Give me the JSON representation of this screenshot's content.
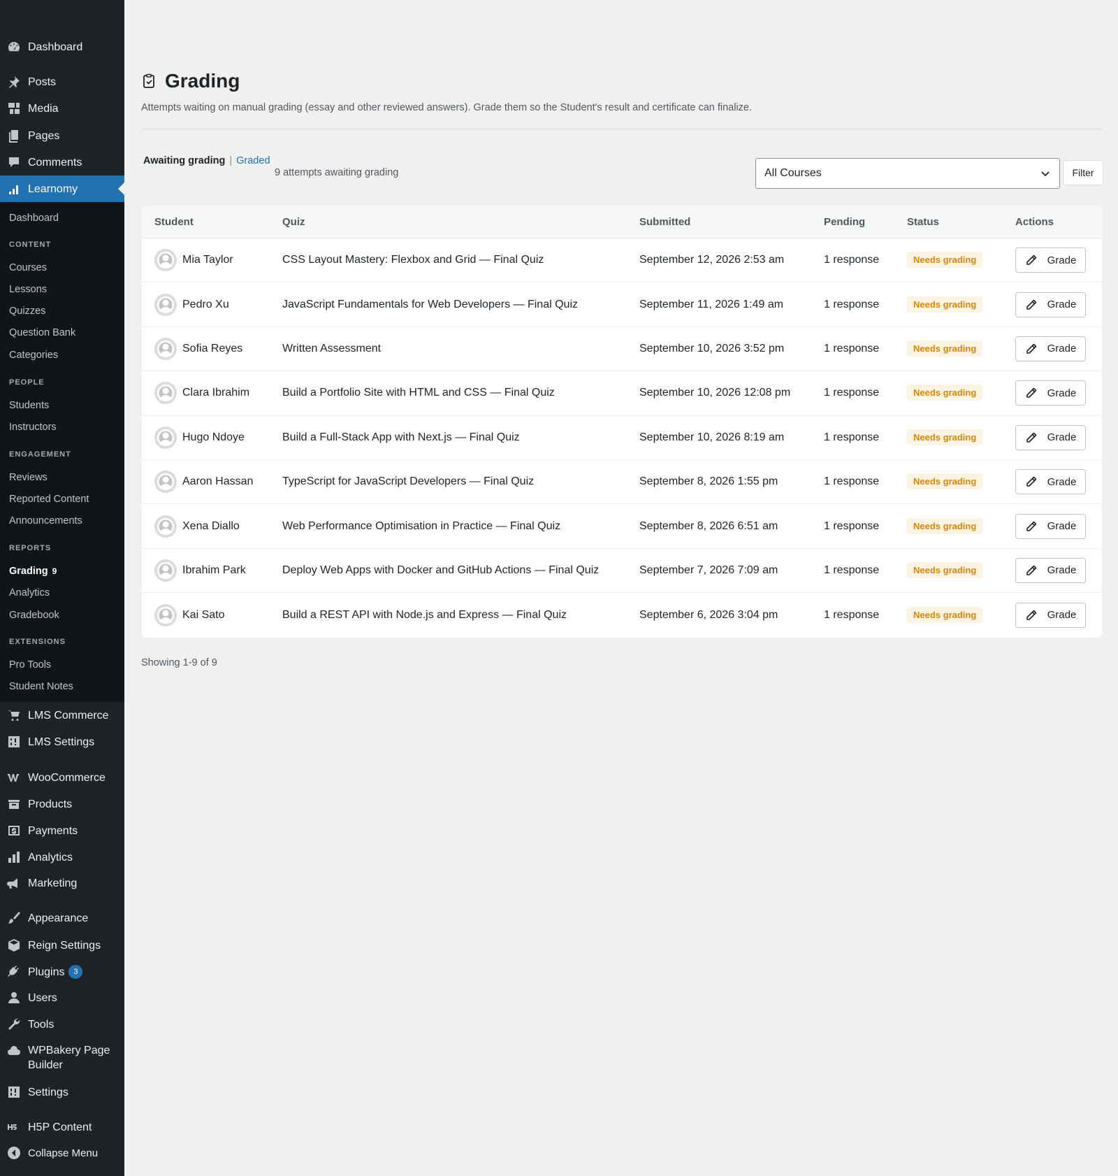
{
  "sidebar": {
    "top_items": [
      {
        "label": "Dashboard",
        "icon": "dashboard-icon"
      },
      {
        "label": "Posts",
        "icon": "pin-icon"
      },
      {
        "label": "Media",
        "icon": "media-icon"
      },
      {
        "label": "Pages",
        "icon": "pages-icon"
      },
      {
        "label": "Comments",
        "icon": "comment-icon"
      },
      {
        "label": "Learnomy",
        "icon": "chart-icon"
      }
    ],
    "submenu": {
      "dashboard": "Dashboard",
      "content_heading": "CONTENT",
      "content": [
        "Courses",
        "Lessons",
        "Quizzes",
        "Question Bank",
        "Categories"
      ],
      "people_heading": "PEOPLE",
      "people": [
        "Students",
        "Instructors"
      ],
      "engagement_heading": "ENGAGEMENT",
      "engagement": [
        "Reviews",
        "Reported Content",
        "Announcements"
      ],
      "reports_heading": "REPORTS",
      "grading": "Grading",
      "grading_count": "9",
      "reports": [
        "Analytics",
        "Gradebook"
      ],
      "extensions_heading": "EXTENSIONS",
      "extensions": [
        "Pro Tools",
        "Student Notes"
      ]
    },
    "bottom_items": [
      {
        "label": "LMS Commerce",
        "icon": "cart-icon"
      },
      {
        "label": "LMS Settings",
        "icon": "settings-grid-icon"
      },
      {
        "label": "WooCommerce",
        "icon": "woo-icon"
      },
      {
        "label": "Products",
        "icon": "archive-icon"
      },
      {
        "label": "Payments",
        "icon": "dollar-icon"
      },
      {
        "label": "Analytics",
        "icon": "bar-chart-icon"
      },
      {
        "label": "Marketing",
        "icon": "megaphone-icon"
      },
      {
        "label": "Appearance",
        "icon": "brush-icon"
      },
      {
        "label": "Reign Settings",
        "icon": "cube-icon"
      },
      {
        "label": "Plugins",
        "icon": "plug-icon",
        "count": "3"
      },
      {
        "label": "Users",
        "icon": "user-icon"
      },
      {
        "label": "Tools",
        "icon": "wrench-icon"
      },
      {
        "label": "WPBakery Page\nBuilder",
        "icon": "cloud-icon"
      },
      {
        "label": "Settings",
        "icon": "sliders-icon"
      },
      {
        "label": "H5P Content",
        "icon": "h5p-icon"
      },
      {
        "label": "Collapse Menu",
        "icon": "collapse-icon"
      }
    ]
  },
  "page": {
    "title": "Grading",
    "description": "Attempts waiting on manual grading (essay and other reviewed answers). Grade them so the Student's result and certificate can finalize.",
    "views": {
      "current": "Awaiting grading",
      "separator": "|",
      "other": "Graded"
    },
    "attempt_count": "9 attempts awaiting grading",
    "course_filter": "All Courses",
    "filter_button": "Filter",
    "showing": "Showing 1-9 of 9"
  },
  "table": {
    "headers": [
      "Student",
      "Quiz",
      "Submitted",
      "Pending",
      "Status",
      "Actions"
    ],
    "rows": [
      {
        "student": "Mia Taylor",
        "quiz": "CSS Layout Mastery: Flexbox and Grid — Final Quiz",
        "submitted": "September 12, 2026 2:53 am",
        "pending": "1 response",
        "status": "Needs grading",
        "action": "Grade"
      },
      {
        "student": "Pedro Xu",
        "quiz": "JavaScript Fundamentals for Web Developers — Final Quiz",
        "submitted": "September 11, 2026 1:49 am",
        "pending": "1 response",
        "status": "Needs grading",
        "action": "Grade"
      },
      {
        "student": "Sofia Reyes",
        "quiz": "Written Assessment",
        "submitted": "September 10, 2026 3:52 pm",
        "pending": "1 response",
        "status": "Needs grading",
        "action": "Grade"
      },
      {
        "student": "Clara Ibrahim",
        "quiz": "Build a Portfolio Site with HTML and CSS — Final Quiz",
        "submitted": "September 10, 2026 12:08 pm",
        "pending": "1 response",
        "status": "Needs grading",
        "action": "Grade"
      },
      {
        "student": "Hugo Ndoye",
        "quiz": "Build a Full-Stack App with Next.js — Final Quiz",
        "submitted": "September 10, 2026 8:19 am",
        "pending": "1 response",
        "status": "Needs grading",
        "action": "Grade"
      },
      {
        "student": "Aaron Hassan",
        "quiz": "TypeScript for JavaScript Developers — Final Quiz",
        "submitted": "September 8, 2026 1:55 pm",
        "pending": "1 response",
        "status": "Needs grading",
        "action": "Grade"
      },
      {
        "student": "Xena Diallo",
        "quiz": "Web Performance Optimisation in Practice — Final Quiz",
        "submitted": "September 8, 2026 6:51 am",
        "pending": "1 response",
        "status": "Needs grading",
        "action": "Grade"
      },
      {
        "student": "Ibrahim Park",
        "quiz": "Deploy Web Apps with Docker and GitHub Actions — Final Quiz",
        "submitted": "September 7, 2026 7:09 am",
        "pending": "1 response",
        "status": "Needs grading",
        "action": "Grade"
      },
      {
        "student": "Kai Sato",
        "quiz": "Build a REST API with Node.js and Express — Final Quiz",
        "submitted": "September 6, 2026 3:04 pm",
        "pending": "1 response",
        "status": "Needs grading",
        "action": "Grade"
      }
    ]
  },
  "colors": {
    "accent": "#2271b1",
    "sidebar": "#1d2327",
    "status_text": "#d4870c"
  }
}
